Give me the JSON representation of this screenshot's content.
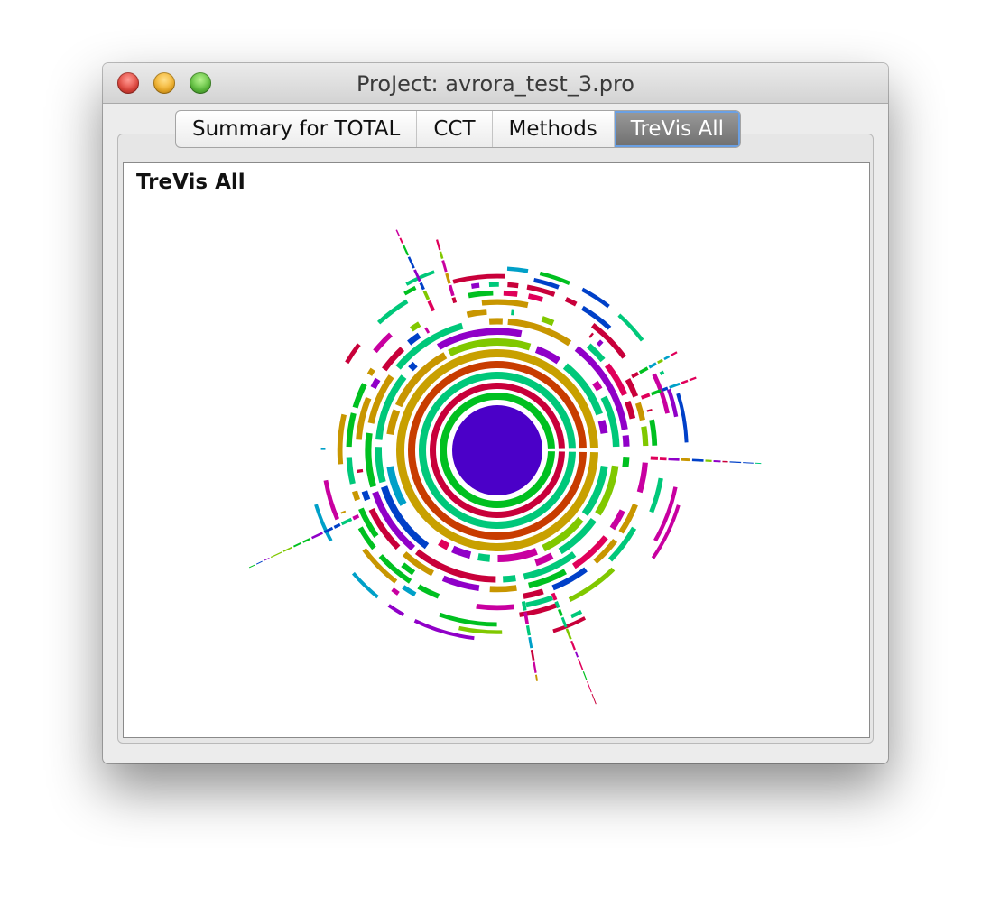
{
  "window": {
    "title": "ProJect: avrora_test_3.pro"
  },
  "tabs": [
    {
      "label": "Summary for TOTAL",
      "active": false
    },
    {
      "label": "CCT",
      "active": false
    },
    {
      "label": "Methods",
      "active": false
    },
    {
      "label": "TreVis All",
      "active": true
    }
  ],
  "panel": {
    "title": "TreVis All"
  },
  "visualization": {
    "type": "sunburst",
    "core_color": "#4b00c8",
    "ring_colors": [
      "#00c020",
      "#c8003a",
      "#00c87a",
      "#c83c00",
      "#c8a000"
    ],
    "palette": [
      "#00c020",
      "#c8003a",
      "#00c87a",
      "#c89600",
      "#9000c8",
      "#0040c8",
      "#00a0c8",
      "#c800a0",
      "#80c800",
      "#e0005a"
    ]
  }
}
